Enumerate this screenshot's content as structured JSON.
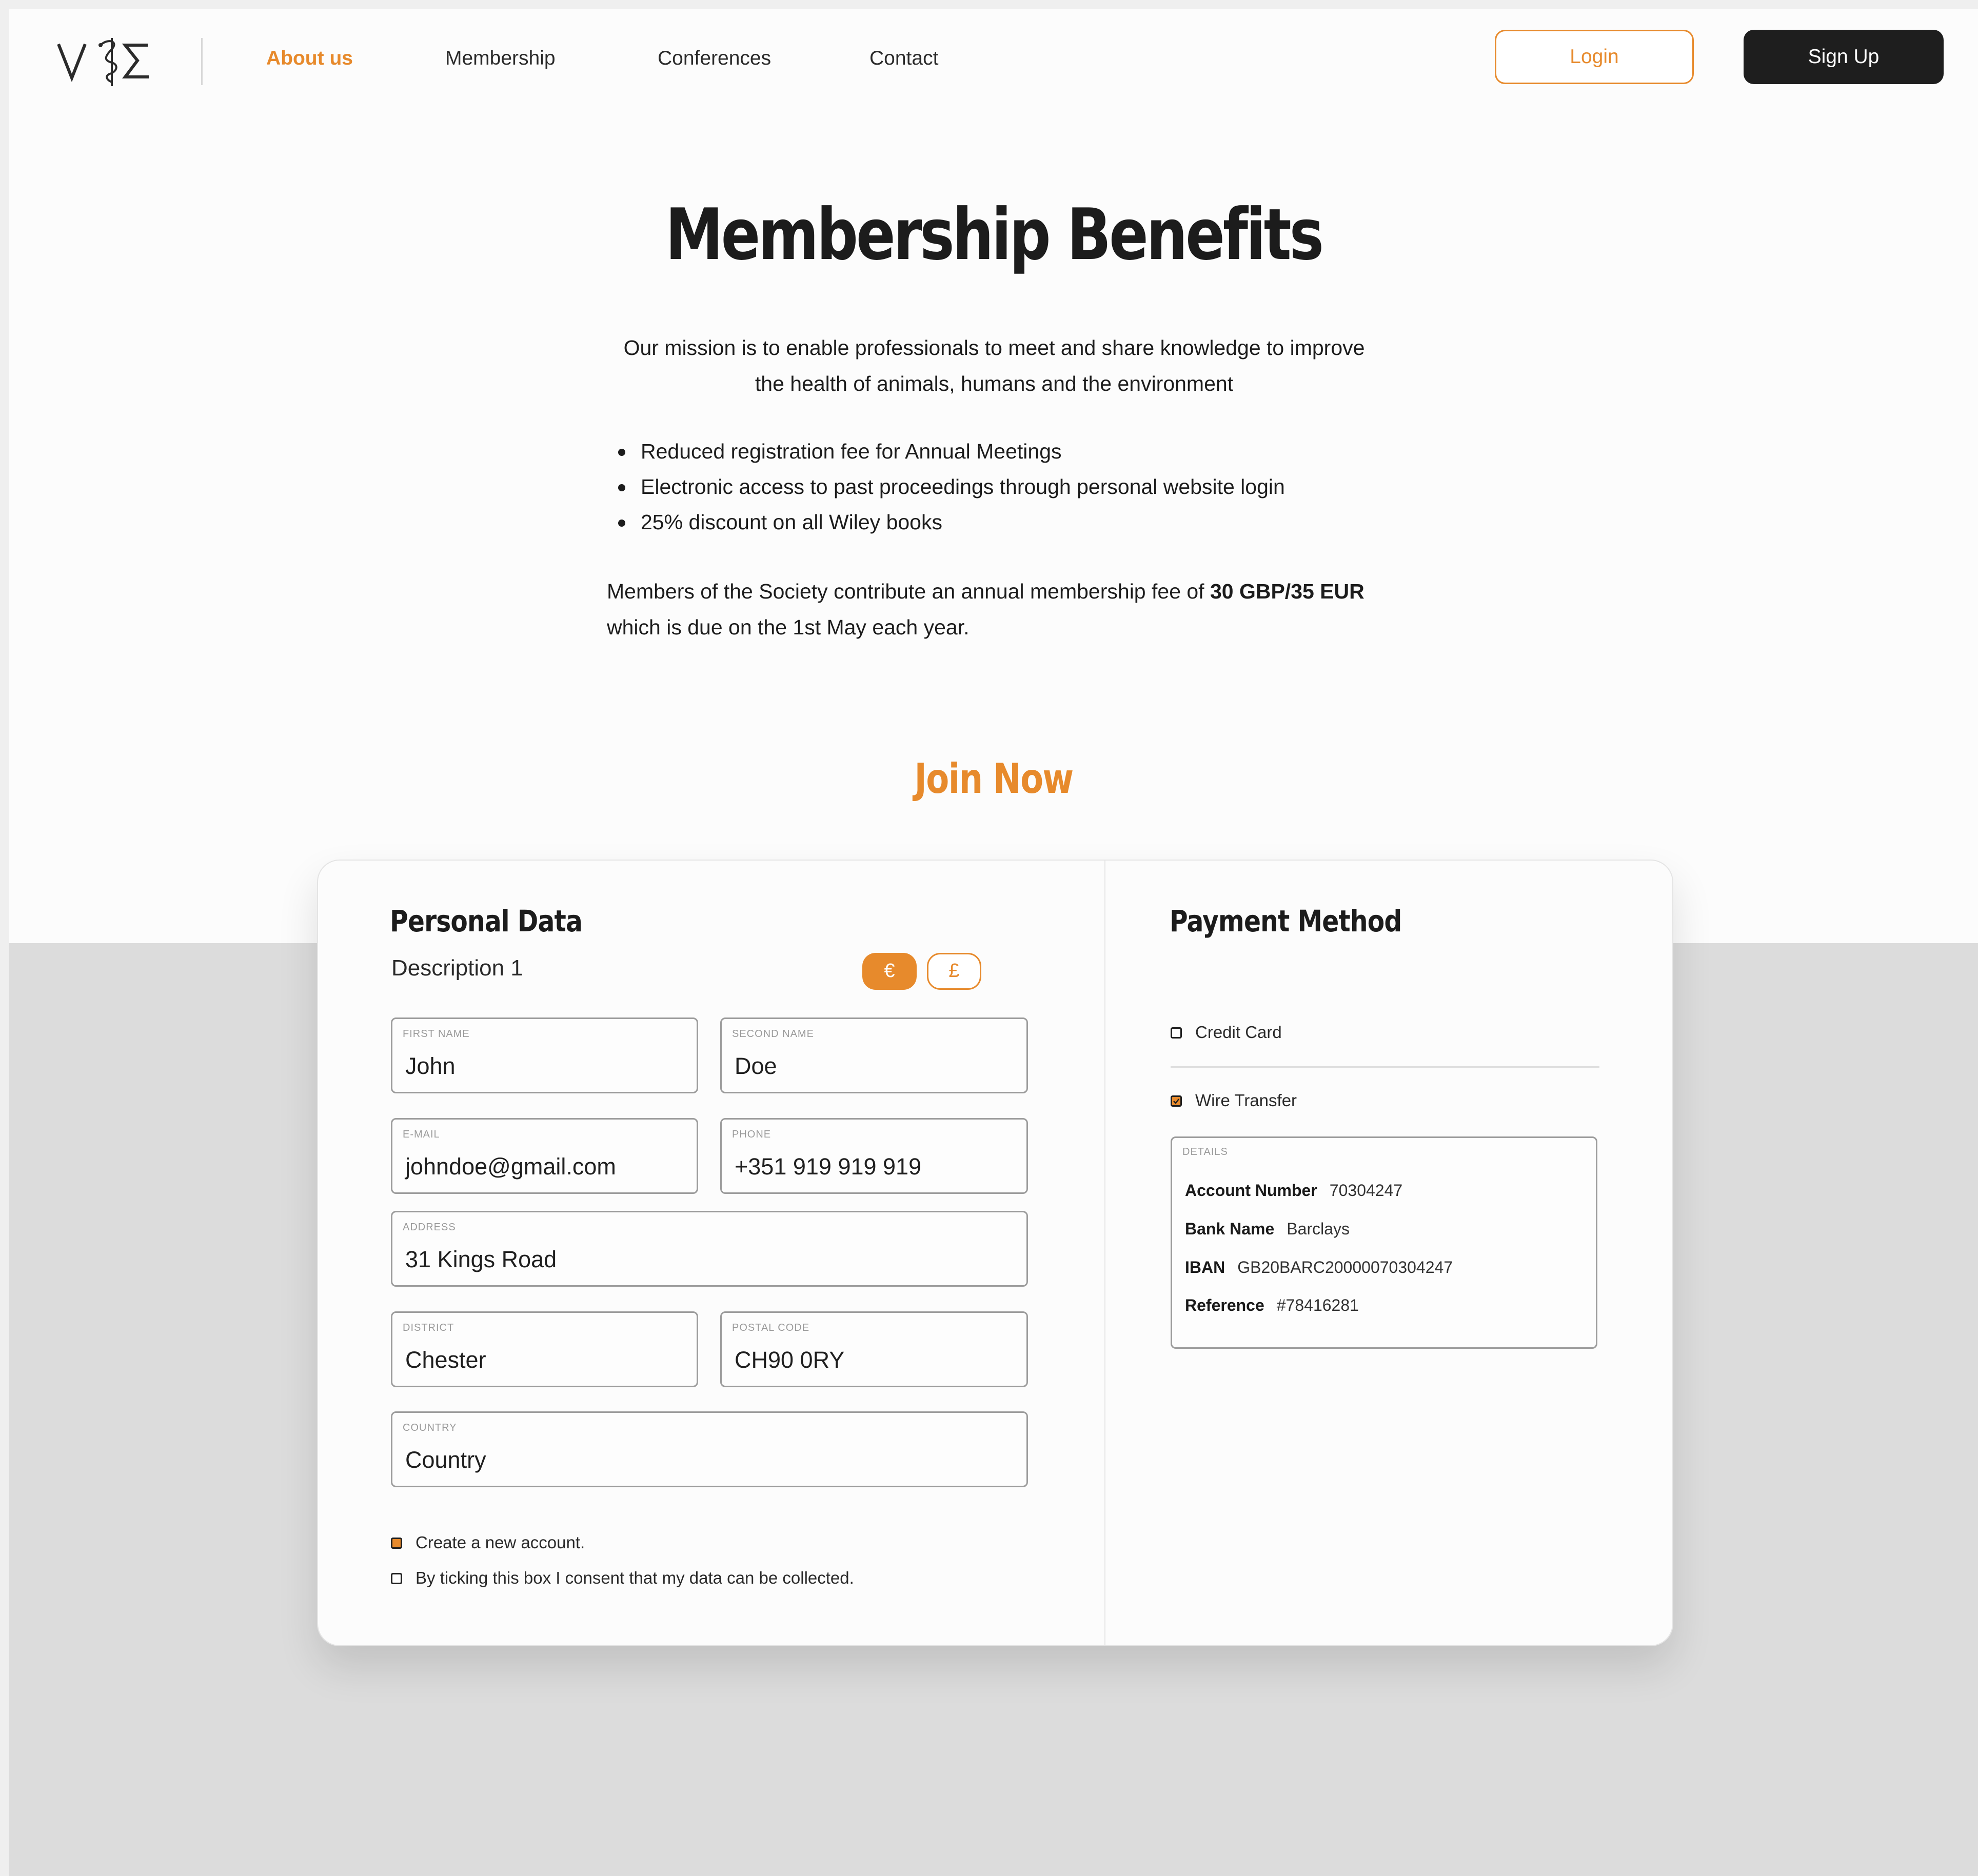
{
  "nav": {
    "links": [
      "About us",
      "Membership",
      "Conferences",
      "Contact"
    ],
    "active": "About us",
    "login_label": "Login",
    "signup_label": "Sign Up"
  },
  "hero": {
    "title": "Membership Benefits",
    "mission_line1": "Our mission is to enable professionals to meet and share knowledge to improve",
    "mission_line2": "the health of animals, humans and the environment",
    "benefits": [
      "Reduced registration fee for Annual Meetings",
      "Electronic access to past proceedings through personal website login",
      "25% discount on all Wiley books"
    ],
    "fee_prefix": "Members of the Society contribute an annual membership fee of ",
    "fee_amount": "30 GBP/35 EUR",
    "fee_suffix": "which is due on the 1st May each year."
  },
  "join_title": "Join Now",
  "personal": {
    "title": "Personal Data",
    "description": "Description 1",
    "fields": {
      "first_name": {
        "label": "First Name",
        "value": "John"
      },
      "second_name": {
        "label": "Second Name",
        "value": "Doe"
      },
      "email": {
        "label": "E-mail",
        "value": "johndoe@gmail.com"
      },
      "phone": {
        "label": "Phone",
        "value": "+351 919 919 919"
      },
      "address": {
        "label": "Address",
        "value": "31 Kings Road"
      },
      "district": {
        "label": "District",
        "value": "Chester"
      },
      "postal_code": {
        "label": "Postal Code",
        "value": "CH90 0RY"
      },
      "country": {
        "label": "Country",
        "value": "Country"
      }
    },
    "create_account": {
      "label": "Create a new account.",
      "checked": true
    },
    "consent": {
      "label": "By ticking this box I consent that my data can be collected.",
      "checked": false
    }
  },
  "payment": {
    "title": "Payment Method",
    "currencies": [
      "€",
      "£"
    ],
    "selected_currency": "€",
    "credit_card": {
      "label": "Credit Card",
      "checked": false
    },
    "wire_transfer": {
      "label": "Wire Transfer",
      "checked": true
    },
    "details_label": "DETAILS",
    "details": {
      "account_number": {
        "key": "Account Number",
        "value": "70304247"
      },
      "bank_name": {
        "key": "Bank Name",
        "value": "Barclays"
      },
      "iban": {
        "key": "IBAN",
        "value": "GB20BARC20000070304247"
      },
      "reference": {
        "key": "Reference",
        "value": "#78416281"
      }
    }
  },
  "colors": {
    "accent": "#e78a2c",
    "dark": "#1e1e1e",
    "lower_bg": "#dcdcdc"
  }
}
